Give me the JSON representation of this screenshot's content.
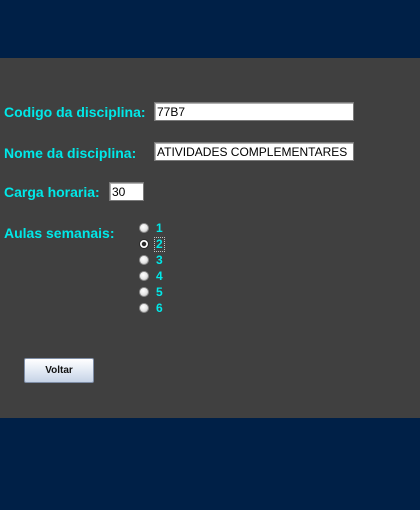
{
  "form": {
    "codigo": {
      "label": "Codigo da disciplina:",
      "value": "77B7"
    },
    "nome": {
      "label": "Nome da disciplina:",
      "value": "ATIVIDADES COMPLEMENTARES"
    },
    "carga": {
      "label": "Carga horaria:",
      "value": "30"
    },
    "aulas": {
      "label": "Aulas semanais:",
      "selected": "2",
      "options": [
        {
          "label": "1"
        },
        {
          "label": "2"
        },
        {
          "label": "3"
        },
        {
          "label": "4"
        },
        {
          "label": "5"
        },
        {
          "label": "6"
        }
      ]
    }
  },
  "actions": {
    "voltar_label": "Voltar"
  },
  "colors": {
    "background": "#002047",
    "panel": "#404040",
    "label": "#00e8e8"
  }
}
